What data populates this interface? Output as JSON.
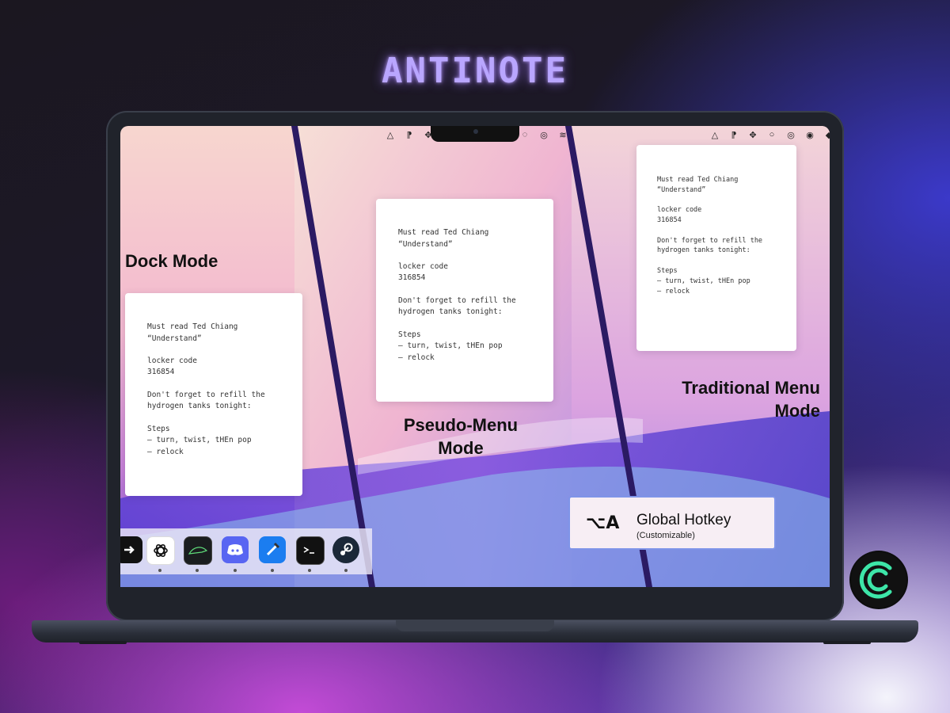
{
  "app_title": "ANTINOTE",
  "note": {
    "lines": [
      "Must read Ted Chiang",
      "“Understand”",
      "",
      "locker code",
      "316854",
      "",
      "Don't forget to refill the",
      "hydrogen tanks tonight:",
      "",
      "Steps",
      "– turn, twist, tHEn pop",
      "– relock"
    ]
  },
  "modes": {
    "dock": "Dock Mode",
    "pseudo_menu_line1": "Pseudo-Menu",
    "pseudo_menu_line2": "Mode",
    "traditional_line1": "Traditional Menu",
    "traditional_line2": "Mode"
  },
  "hotkey": {
    "symbol": "⌥A",
    "title": "Global Hotkey",
    "subtitle": "(Customizable)"
  },
  "menubar_icons": [
    "triangle-icon",
    "note-icon",
    "dropbox-icon",
    "circle-icon",
    "target-icon",
    "wifi-icon"
  ],
  "dock_apps": [
    "antinote-app",
    "chatgpt-app",
    "terminal-green-app",
    "discord-app",
    "xcode-app",
    "terminal-app",
    "steam-app"
  ],
  "colors": {
    "accent": "#b9a6ff",
    "divider": "#2b1a63",
    "hotkey_border": "#7f94e8"
  }
}
